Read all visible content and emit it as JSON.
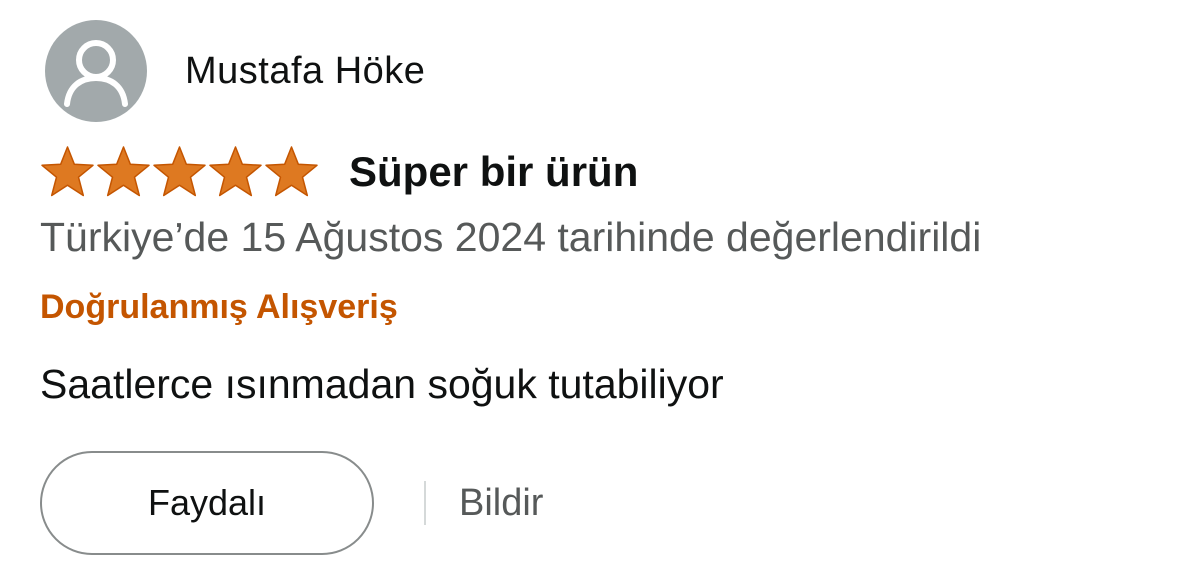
{
  "reviewer": {
    "name": "Mustafa Höke",
    "avatar_icon": "user-silhouette-icon"
  },
  "rating": {
    "stars": 5,
    "max_stars": 5,
    "star_color": "#de7921",
    "star_icon": "star-icon"
  },
  "review": {
    "title": "Süper bir ürün",
    "date_text": "Türkiye’de 15 Ağustos 2024 tarihinde değerlendirildi",
    "verified_label": "Doğrulanmış Alışveriş",
    "body": "Saatlerce ısınmadan soğuk tutabiliyor"
  },
  "actions": {
    "helpful_label": "Faydalı",
    "report_label": "Bildir"
  },
  "colors": {
    "verified": "#c45500",
    "secondary_text": "#565959",
    "avatar_bg": "#a2a9ab"
  }
}
